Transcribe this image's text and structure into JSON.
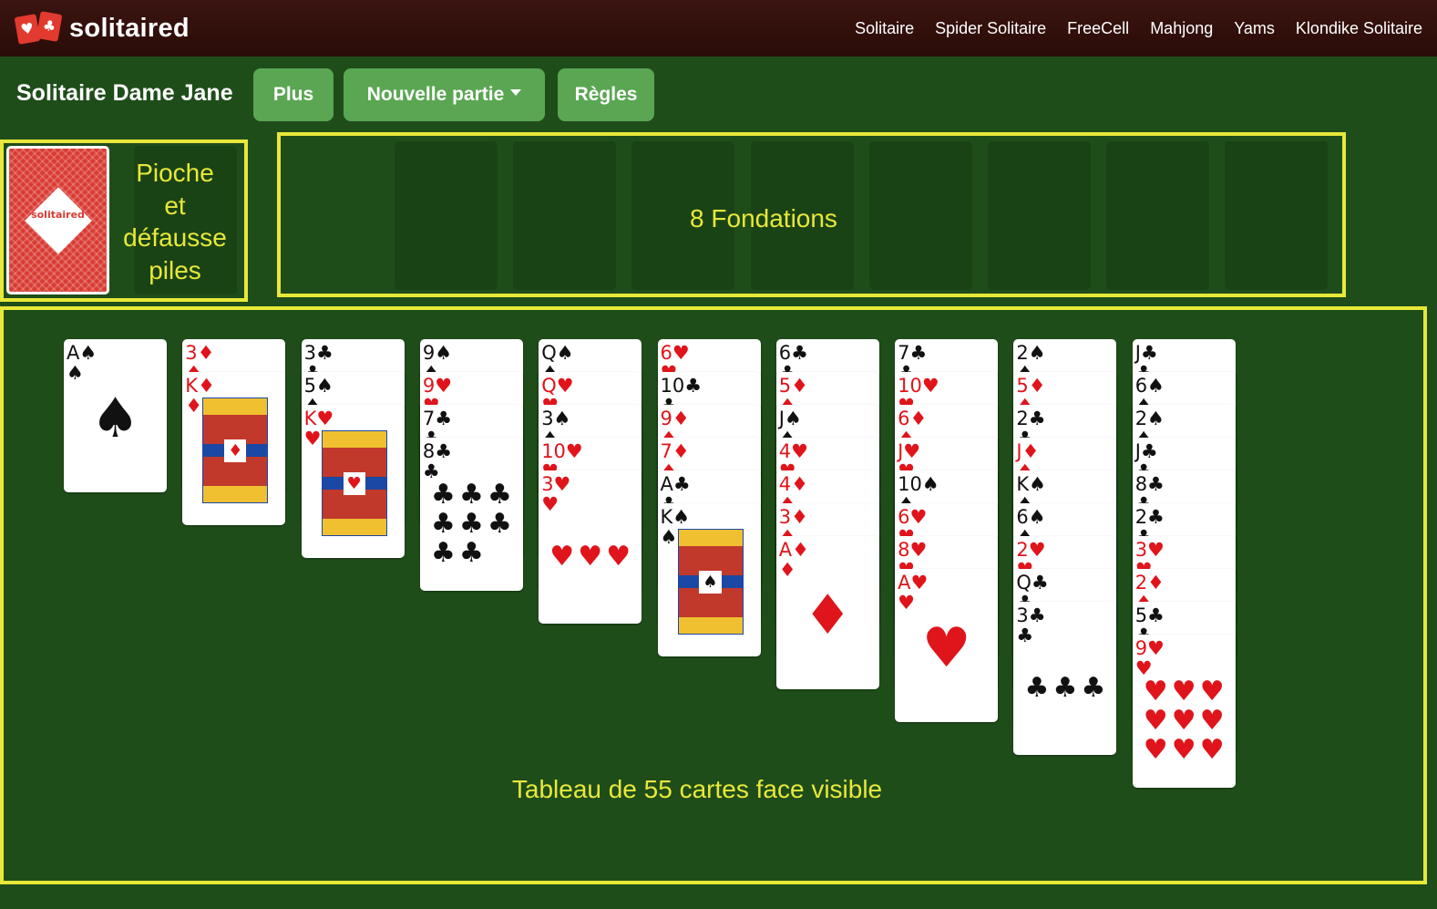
{
  "header": {
    "logo_text": "solitaired",
    "nav": [
      "Solitaire",
      "Spider Solitaire",
      "FreeCell",
      "Mahjong",
      "Yams",
      "Klondike Solitaire"
    ]
  },
  "toolbar": {
    "title": "Solitaire Dame Jane",
    "btn_more": "Plus",
    "btn_new": "Nouvelle partie",
    "btn_rules": "Règles"
  },
  "labels": {
    "stock": [
      "Pioche",
      "et",
      "défausse",
      "piles"
    ],
    "foundations": "8 Fondations",
    "tableau": "Tableau de 55 cartes face visible"
  },
  "colors": {
    "felt": "#1f4d1a",
    "accent": "#e8e83a",
    "button": "#5aa653",
    "card_back": "#d93a32"
  },
  "foundations_count": 8,
  "tableau": [
    [
      [
        "A",
        "♠"
      ]
    ],
    [
      [
        "3",
        "♦"
      ],
      [
        "K",
        "♦"
      ]
    ],
    [
      [
        "3",
        "♣"
      ],
      [
        "5",
        "♠"
      ],
      [
        "K",
        "♥"
      ]
    ],
    [
      [
        "9",
        "♠"
      ],
      [
        "9",
        "♥"
      ],
      [
        "7",
        "♣"
      ],
      [
        "8",
        "♣"
      ]
    ],
    [
      [
        "Q",
        "♠"
      ],
      [
        "Q",
        "♥"
      ],
      [
        "3",
        "♠"
      ],
      [
        "10",
        "♥"
      ],
      [
        "3",
        "♥"
      ]
    ],
    [
      [
        "6",
        "♥"
      ],
      [
        "10",
        "♣"
      ],
      [
        "9",
        "♦"
      ],
      [
        "7",
        "♦"
      ],
      [
        "A",
        "♣"
      ],
      [
        "K",
        "♠"
      ]
    ],
    [
      [
        "6",
        "♣"
      ],
      [
        "5",
        "♦"
      ],
      [
        "J",
        "♠"
      ],
      [
        "4",
        "♥"
      ],
      [
        "4",
        "♦"
      ],
      [
        "3",
        "♦"
      ],
      [
        "A",
        "♦"
      ]
    ],
    [
      [
        "7",
        "♣"
      ],
      [
        "10",
        "♥"
      ],
      [
        "6",
        "♦"
      ],
      [
        "J",
        "♥"
      ],
      [
        "10",
        "♠"
      ],
      [
        "6",
        "♥"
      ],
      [
        "8",
        "♥"
      ],
      [
        "A",
        "♥"
      ]
    ],
    [
      [
        "2",
        "♠"
      ],
      [
        "5",
        "♦"
      ],
      [
        "2",
        "♣"
      ],
      [
        "J",
        "♦"
      ],
      [
        "K",
        "♠"
      ],
      [
        "6",
        "♠"
      ],
      [
        "2",
        "♥"
      ],
      [
        "Q",
        "♣"
      ],
      [
        "3",
        "♣"
      ]
    ],
    [
      [
        "J",
        "♣"
      ],
      [
        "6",
        "♠"
      ],
      [
        "2",
        "♠"
      ],
      [
        "J",
        "♣"
      ],
      [
        "8",
        "♣"
      ],
      [
        "2",
        "♣"
      ],
      [
        "3",
        "♥"
      ],
      [
        "2",
        "♦"
      ],
      [
        "5",
        "♣"
      ],
      [
        "9",
        "♥"
      ]
    ]
  ]
}
